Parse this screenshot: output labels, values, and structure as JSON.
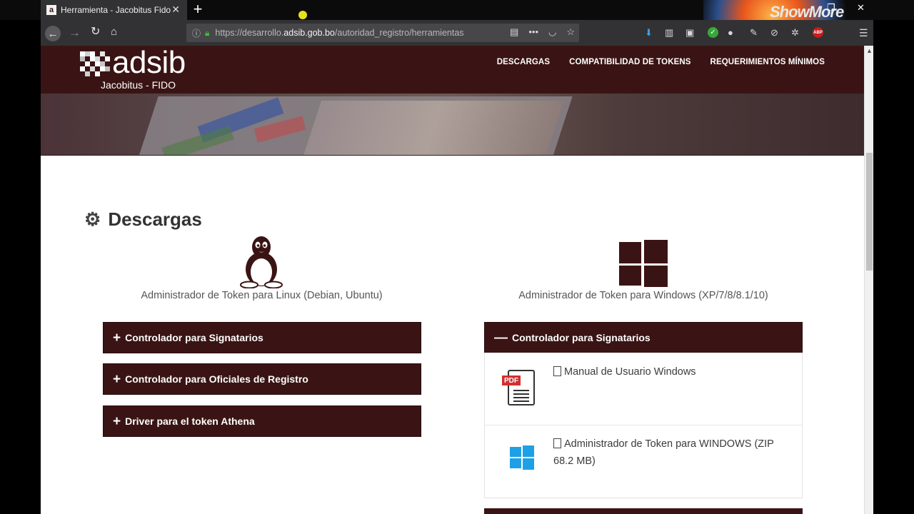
{
  "browser": {
    "tab_title": "Herramienta - Jacobitus Fido",
    "tab_favicon": "a",
    "newtab_label": "+",
    "url_prefix": "https://desarrollo.",
    "url_host": "adsib.gob.bo",
    "url_path": "/autoridad_registro/herramientas",
    "watermark": "ShowMore"
  },
  "site": {
    "logo_text": "adsib",
    "logo_subtitle": "Jacobitus - FIDO",
    "nav": [
      {
        "label": "DESCARGAS"
      },
      {
        "label": "COMPATIBILIDAD DE TOKENS"
      },
      {
        "label": "REQUERIMIENTOS MÍNIMOS"
      }
    ]
  },
  "main": {
    "section_title": "Descargas",
    "linux": {
      "label": "Administrador de Token para Linux (Debian, Ubuntu)",
      "panels": [
        {
          "label": "Controlador para Signatarios",
          "state": "+"
        },
        {
          "label": "Controlador para Oficiales de Registro",
          "state": "+"
        },
        {
          "label": "Driver para el token Athena",
          "state": "+"
        }
      ]
    },
    "windows": {
      "label": "Administrador de Token para Windows (XP/7/8/8.1/10)",
      "panels": [
        {
          "label": "Controlador para Signatarios",
          "state": "—"
        }
      ],
      "items": [
        {
          "text": "Manual de Usuario Windows",
          "icon": "pdf-icon",
          "badge": "PDF"
        },
        {
          "text": "Administrador de Token para WINDOWS (ZIP 68.2 MB)",
          "icon": "windows-icon"
        }
      ]
    }
  },
  "colors": {
    "brand": "#3a1414",
    "accent_blue": "#1ea0e6",
    "pdf_red": "#d32f2f"
  }
}
